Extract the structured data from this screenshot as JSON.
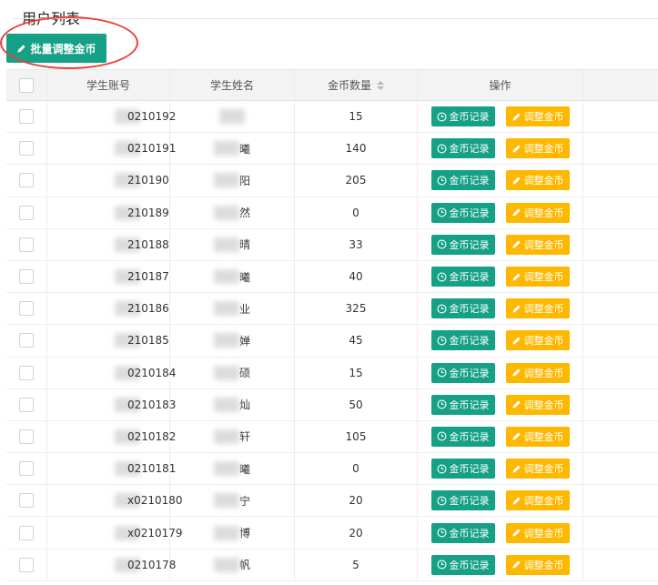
{
  "page": {
    "title": "用户列表"
  },
  "toolbar": {
    "batch_adjust_label": "批量调整金币"
  },
  "colors": {
    "primary": "#16a085",
    "warning": "#ffb800",
    "annotation_ring": "#e8413b"
  },
  "table": {
    "columns": {
      "account": "学生账号",
      "name": "学生姓名",
      "coins": "金币数量",
      "actions": "操作"
    },
    "row_actions": {
      "record": "金币记录",
      "adjust": "调整金币"
    },
    "rows": [
      {
        "account": "0210192",
        "name": "",
        "coins": "15"
      },
      {
        "account": "0210191",
        "name": "曦",
        "coins": "140"
      },
      {
        "account": "210190",
        "name": "阳",
        "coins": "205"
      },
      {
        "account": "210189",
        "name": "然",
        "coins": "0"
      },
      {
        "account": "210188",
        "name": "晴",
        "coins": "33"
      },
      {
        "account": "210187",
        "name": "曦",
        "coins": "40"
      },
      {
        "account": "210186",
        "name": "业",
        "coins": "325"
      },
      {
        "account": "210185",
        "name": "婵",
        "coins": "45"
      },
      {
        "account": "0210184",
        "name": "硕",
        "coins": "15"
      },
      {
        "account": "0210183",
        "name": "灿",
        "coins": "50"
      },
      {
        "account": "0210182",
        "name": "轩",
        "coins": "105"
      },
      {
        "account": "0210181",
        "name": "曦",
        "coins": "0"
      },
      {
        "account": "x0210180",
        "name": "宁",
        "coins": "20"
      },
      {
        "account": "x0210179",
        "name": "博",
        "coins": "20"
      },
      {
        "account": "0210178",
        "name": "帆",
        "coins": "5"
      }
    ]
  }
}
